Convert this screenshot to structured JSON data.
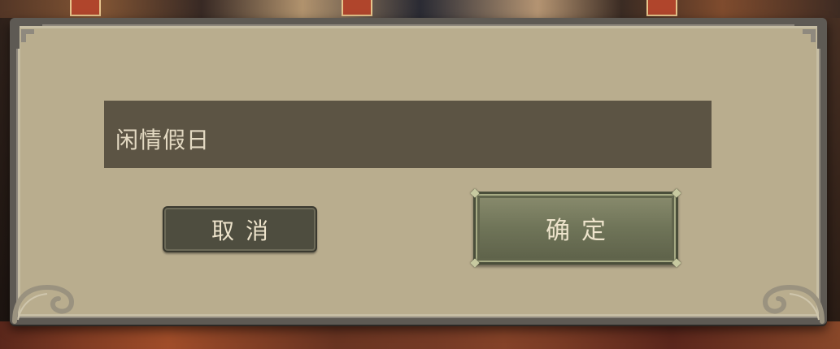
{
  "dialog": {
    "input": {
      "value": "闲情假日"
    },
    "cancel_label": "取消",
    "confirm_label": "确定"
  },
  "colors": {
    "panel": "#b9ad8e",
    "frame": "#5e5a54",
    "input_bg": "#5c5444",
    "cancel_bg": "#4e4d3f",
    "confirm_bg": "#6f7458",
    "text": "#ede3cb"
  }
}
